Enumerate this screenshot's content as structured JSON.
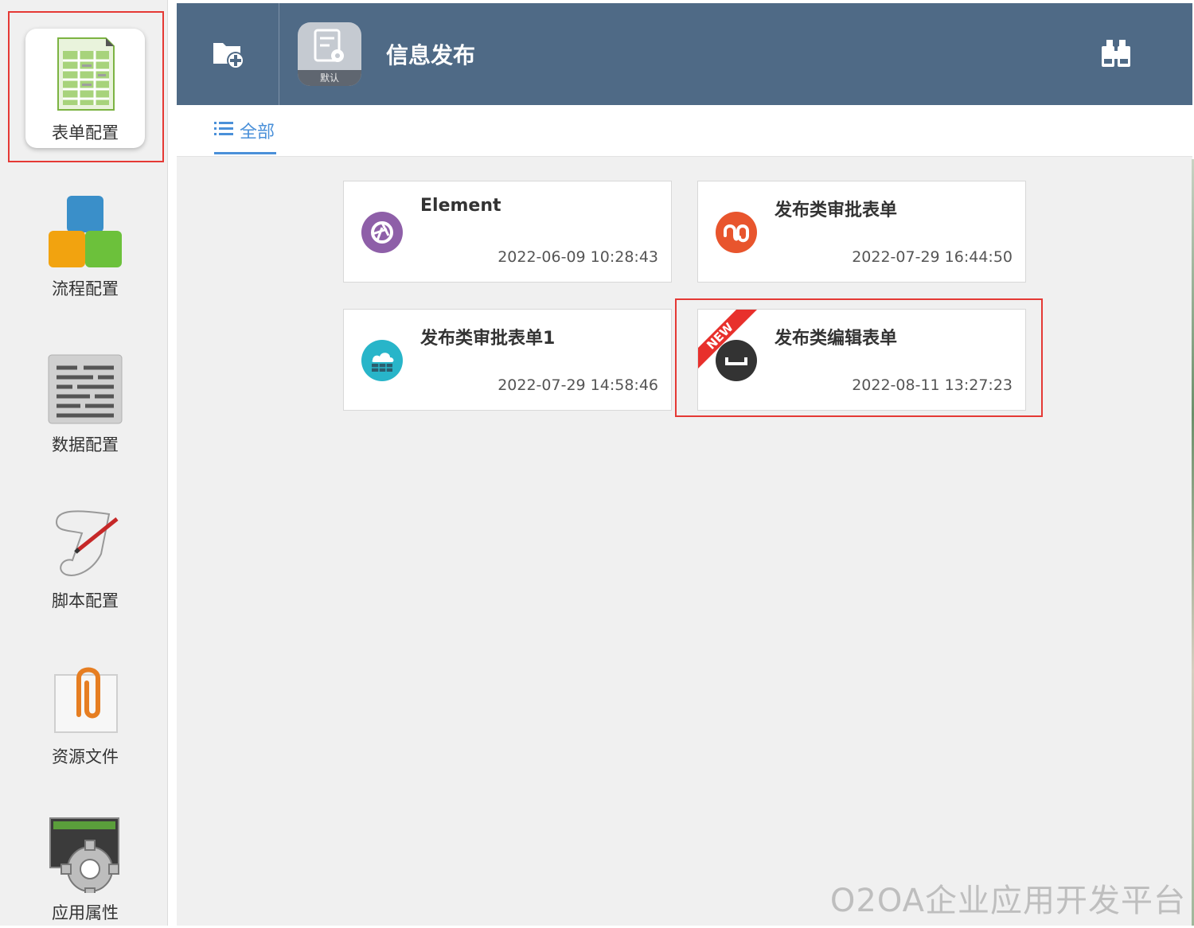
{
  "sidebar": {
    "items": [
      {
        "label": "表单配置",
        "icon": "form-table-icon",
        "active": true
      },
      {
        "label": "流程配置",
        "icon": "process-blocks-icon",
        "active": false
      },
      {
        "label": "数据配置",
        "icon": "data-lines-icon",
        "active": false
      },
      {
        "label": "脚本配置",
        "icon": "script-scroll-icon",
        "active": false
      },
      {
        "label": "资源文件",
        "icon": "paperclip-file-icon",
        "active": false
      },
      {
        "label": "应用属性",
        "icon": "gear-screen-icon",
        "active": false
      }
    ]
  },
  "header": {
    "add_icon": "add-folder-icon",
    "app_icon_badge": "默认",
    "title": "信息发布",
    "search_icon": "binoculars-icon",
    "bg_color": "#4f6a86"
  },
  "tabs": [
    {
      "label": "全部",
      "icon": "list-icon",
      "active": true
    }
  ],
  "cards": [
    {
      "title": "Element",
      "date": "2022-06-09 10:28:43",
      "icon_color": "#8e5fa8",
      "is_new": false
    },
    {
      "title": "发布类审批表单",
      "date": "2022-07-29 16:44:50",
      "icon_color": "#e8552d",
      "is_new": false
    },
    {
      "title": "发布类审批表单1",
      "date": "2022-07-29 14:58:46",
      "icon_color": "#28b5c9",
      "is_new": false
    },
    {
      "title": "发布类编辑表单",
      "date": "2022-08-11 13:27:23",
      "icon_color": "#333333",
      "is_new": true,
      "new_label": "NEW"
    }
  ],
  "watermark": "O2OA企业应用开发平台",
  "colors": {
    "accent": "#4a90d9",
    "highlight": "#e53935",
    "ribbon": "#e8302c"
  }
}
